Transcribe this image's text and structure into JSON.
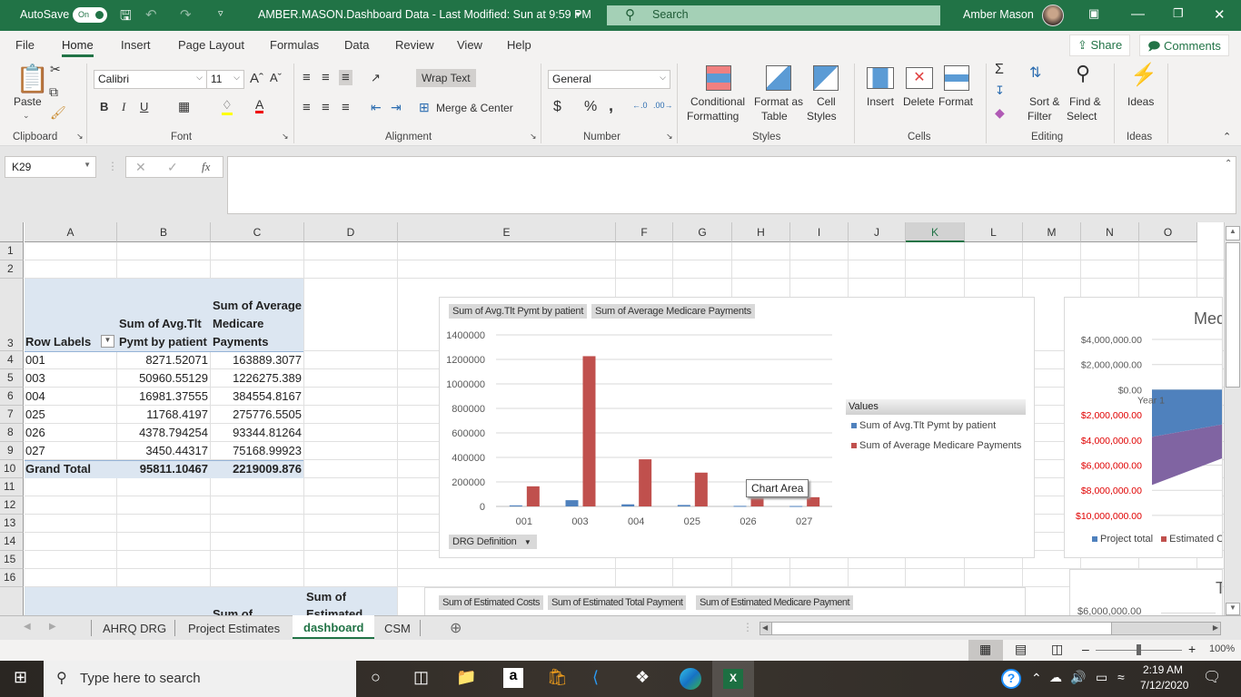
{
  "titlebar": {
    "autosave_label": "AutoSave",
    "autosave_state": "On",
    "document_title": "AMBER.MASON.Dashboard Data  -  Last Modified: Sun at 9:59 PM",
    "search_placeholder": "Search",
    "user_name": "Amber Mason"
  },
  "menu": {
    "tabs": [
      "File",
      "Home",
      "Insert",
      "Page Layout",
      "Formulas",
      "Data",
      "Review",
      "View",
      "Help"
    ],
    "active_tab": "Home",
    "share_label": "Share",
    "comments_label": "Comments"
  },
  "ribbon": {
    "clipboard": {
      "paste": "Paste",
      "group": "Clipboard"
    },
    "font": {
      "name": "Calibri",
      "size": "11",
      "bold": "B",
      "italic": "I",
      "underline": "U",
      "group": "Font"
    },
    "alignment": {
      "wrap_text": "Wrap Text",
      "merge_center": "Merge & Center",
      "group": "Alignment"
    },
    "number": {
      "format": "General",
      "currency": "$",
      "percent": "%",
      "comma": ",",
      "group": "Number"
    },
    "styles": {
      "conditional": "Conditional",
      "conditional2": "Formatting",
      "format_as": "Format as",
      "format_as2": "Table",
      "cell": "Cell",
      "cell2": "Styles",
      "group": "Styles"
    },
    "cells": {
      "insert": "Insert",
      "delete": "Delete",
      "format": "Format",
      "group": "Cells"
    },
    "editing": {
      "sort": "Sort &",
      "sort2": "Filter",
      "find": "Find &",
      "find2": "Select",
      "group": "Editing"
    },
    "ideas": {
      "label": "Ideas",
      "group": "Ideas"
    }
  },
  "formula_bar": {
    "name_box": "K29",
    "formula": ""
  },
  "columns": [
    "A",
    "B",
    "C",
    "D",
    "E",
    "F",
    "G",
    "H",
    "I",
    "J",
    "K",
    "L",
    "M",
    "N",
    "O"
  ],
  "selected_column": "K",
  "rows": [
    "1",
    "2",
    "3",
    "4",
    "5",
    "6",
    "7",
    "8",
    "9",
    "10",
    "11",
    "12",
    "13",
    "14",
    "15",
    "16"
  ],
  "pivot": {
    "header_row_labels": "Row Labels",
    "header_b": [
      "Sum of Avg.Tlt",
      "Pymt by patient"
    ],
    "header_c": [
      "Sum of Average",
      "Medicare",
      "Payments"
    ],
    "rows": [
      {
        "label": "001",
        "b": "8271.52071",
        "c": "163889.3077"
      },
      {
        "label": "003",
        "b": "50960.55129",
        "c": "1226275.389"
      },
      {
        "label": "004",
        "b": "16981.37555",
        "c": "384554.8167"
      },
      {
        "label": "025",
        "b": "11768.4197",
        "c": "275776.5505"
      },
      {
        "label": "026",
        "b": "4378.794254",
        "c": "93344.81264"
      },
      {
        "label": "027",
        "b": "3450.44317",
        "c": "75168.99923"
      }
    ],
    "total": {
      "label": "Grand Total",
      "b": "95811.10467",
      "c": "2219009.876"
    }
  },
  "pivot2": {
    "header_c": "Sum of",
    "header_d": [
      "Sum of",
      "Estimated"
    ]
  },
  "chart_data": [
    {
      "type": "bar",
      "field_buttons": [
        "Sum of Avg.Tlt Pymt by patient",
        "Sum of Average Medicare Payments"
      ],
      "axis_field_button": "DRG Definition",
      "categories": [
        "001",
        "003",
        "004",
        "025",
        "026",
        "027"
      ],
      "series": [
        {
          "name": "Sum of Avg.Tlt Pymt by patient",
          "color": "#4f81bd",
          "values": [
            8271.52071,
            50960.55129,
            16981.37555,
            11768.4197,
            4378.794254,
            3450.44317
          ]
        },
        {
          "name": "Sum of Average Medicare Payments",
          "color": "#c0504d",
          "values": [
            163889.3077,
            1226275.389,
            384554.8167,
            275776.5505,
            93344.81264,
            75168.99923
          ]
        }
      ],
      "yticks": [
        "0",
        "200000",
        "400000",
        "600000",
        "800000",
        "1000000",
        "1200000",
        "1400000"
      ],
      "ylim": [
        0,
        1400000
      ],
      "legend_title": "Values",
      "legend_position": "right",
      "tooltip": "Chart Area",
      "grid": true
    },
    {
      "type": "area",
      "title": "Med",
      "categories": [
        "Year 1"
      ],
      "yticks": [
        "$4,000,000.00",
        "$2,000,000.00",
        "$0.00",
        "$2,000,000.00",
        "$4,000,000.00",
        "$6,000,000.00",
        "$8,000,000.00",
        "$10,000,000.00"
      ],
      "negative_tick_color": "#e00000",
      "series": [
        {
          "name": "Project total",
          "color": "#4f81bd"
        },
        {
          "name": "Estimated C",
          "color": "#c0504d"
        }
      ],
      "ylim": [
        -10000000,
        4000000
      ]
    },
    {
      "type": "bar",
      "field_buttons": [
        "Sum of Estimated Costs",
        "Sum of Estimated Total Payment",
        "Sum of Estimated Medicare Payment"
      ]
    },
    {
      "type": "line",
      "title": "T",
      "yticks": [
        "$6,000,000.00"
      ]
    }
  ],
  "sheet_tabs": [
    "AHRQ DRG",
    "Project Estimates",
    "dashboard",
    "CSM"
  ],
  "active_sheet": "dashboard",
  "status": {
    "zoom": "100%"
  },
  "taskbar": {
    "search_placeholder": "Type here to search",
    "time": "2:19 AM",
    "date": "7/12/2020"
  }
}
